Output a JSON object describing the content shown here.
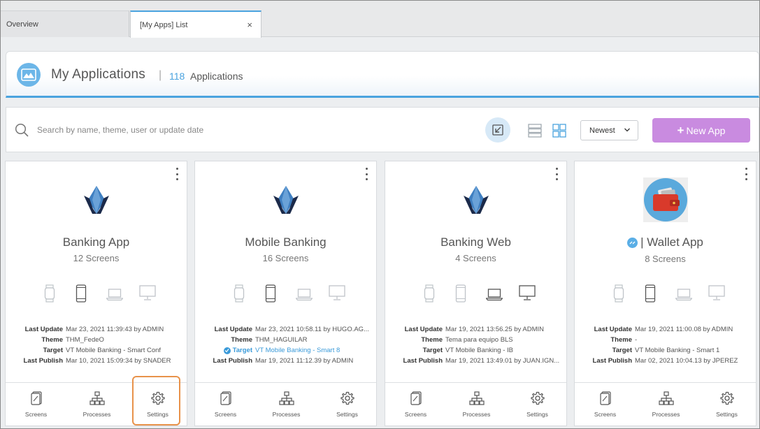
{
  "tabs": {
    "overview": "Overview",
    "active": "[My Apps] List",
    "close_glyph": "×"
  },
  "header": {
    "title": "My Applications",
    "separator": "|",
    "count": "118",
    "count_label": "Applications"
  },
  "toolbar": {
    "search_placeholder": "Search by name, theme, user or update date",
    "sort_value": "Newest",
    "new_app_plus": "+",
    "new_app_label": "New App"
  },
  "colors": {
    "accent": "#4aa3df",
    "new_app": "#c98be0",
    "highlight": "#e8924a",
    "logo_dark": "#1b2a4a",
    "logo_blue": "#3f7fc1"
  },
  "cards": [
    {
      "title": "Banking App",
      "screens": "12 Screens",
      "logo": "velneo-logo",
      "devices_active": [
        false,
        true,
        false,
        false
      ],
      "last_update_k": "Last Update",
      "last_update": "Mar 23, 2021 11:39:43 by ADMIN",
      "theme_k": "Theme",
      "theme": "THM_FedeO",
      "target_k": "Target",
      "target": "VT Mobile Banking - Smart Conf",
      "last_publish_k": "Last Publish",
      "last_publish": "Mar 10, 2021 15:09:34 by SNADER",
      "footer": [
        "Screens",
        "Processes",
        "Settings"
      ]
    },
    {
      "title": "Mobile Banking",
      "screens": "16 Screens",
      "logo": "velneo-logo",
      "devices_active": [
        false,
        true,
        false,
        false
      ],
      "last_update_k": "Last Update",
      "last_update": "Mar 23, 2021 10:58.11 by HUGO.AG...",
      "theme_k": "Theme",
      "theme": "THM_HAGUILAR",
      "target_k": "Target",
      "target": "VT Mobile Banking - Smart 8",
      "last_publish_k": "Last Publish",
      "last_publish": "Mar 19, 2021 11:12.39 by ADMIN",
      "footer": [
        "Screens",
        "Processes",
        "Settings"
      ]
    },
    {
      "title": "Banking Web",
      "screens": "4 Screens",
      "logo": "velneo-logo",
      "devices_active": [
        false,
        false,
        true,
        true
      ],
      "last_update_k": "Last Update",
      "last_update": "Mar 19, 2021 13:56.25 by ADMIN",
      "theme_k": "Theme",
      "theme": "Tema para equipo BLS",
      "target_k": "Target",
      "target": "VT Mobile Banking - IB",
      "last_publish_k": "Last Publish",
      "last_publish": "Mar 19, 2021 13:49.01 by JUAN.IGN...",
      "footer": [
        "Screens",
        "Processes",
        "Settings"
      ]
    },
    {
      "title": "| Wallet App",
      "screens": "8 Screens",
      "logo": "wallet-logo",
      "devices_active": [
        false,
        true,
        false,
        false
      ],
      "last_update_k": "Last Update",
      "last_update": "Mar 19, 2021 11:00.08 by ADMIN",
      "theme_k": "Theme",
      "theme": "-",
      "target_k": "Target",
      "target": "VT Mobile Banking - Smart 1",
      "last_publish_k": "Last Publish",
      "last_publish": "Mar 02, 2021 10:04.13 by JPEREZ",
      "footer": [
        "Screens",
        "Processes",
        "Settings"
      ]
    }
  ]
}
